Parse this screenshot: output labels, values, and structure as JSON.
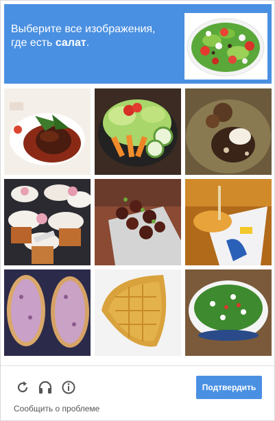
{
  "header": {
    "instruction_line1": "Выберите все изображения,",
    "instruction_prefix": "где есть ",
    "instruction_keyword": "салат",
    "instruction_suffix": "."
  },
  "footer": {
    "verify_label": "Подтвердить",
    "report_label": "Сообщить о проблеме",
    "icons": [
      "reload-icon",
      "audio-headphones-icon",
      "info-icon"
    ]
  },
  "colors": {
    "accent": "#4a90e2",
    "text_on_accent": "#ffffff"
  }
}
